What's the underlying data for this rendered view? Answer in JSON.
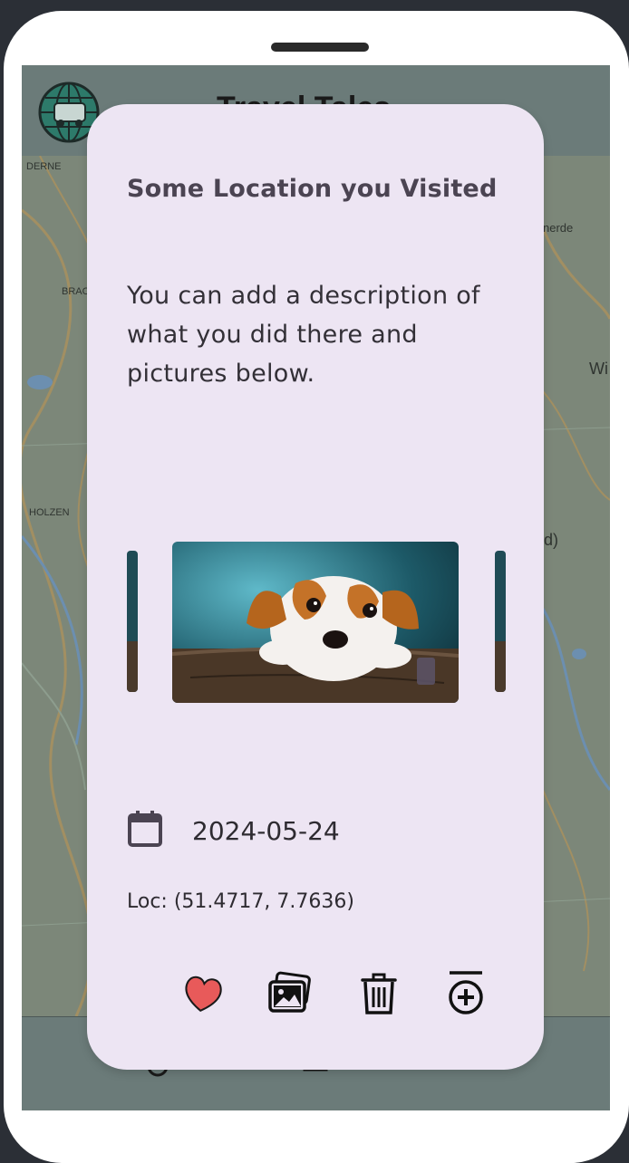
{
  "app": {
    "title": "Travel Tales"
  },
  "map": {
    "labels": [
      "DERNE",
      "BRAC",
      "HOLZEN",
      "nerde",
      "Wi",
      "d)"
    ]
  },
  "modal": {
    "title": "Some Location you Visited",
    "description": "You can add a description of what you did there and pictures below.",
    "date": "2024-05-24",
    "location": "Loc: (51.4717, 7.7636)",
    "actions": {
      "favorite": "heart-icon",
      "gallery": "gallery-icon",
      "delete": "trash-icon",
      "add": "add-circle-icon"
    }
  },
  "nav": {
    "items": [
      "location-pin-icon",
      "home-icon",
      "settings-icon"
    ]
  },
  "colors": {
    "modal_bg": "#ede5f3",
    "heart": "#e85a5a",
    "header": "#6b7b79"
  }
}
